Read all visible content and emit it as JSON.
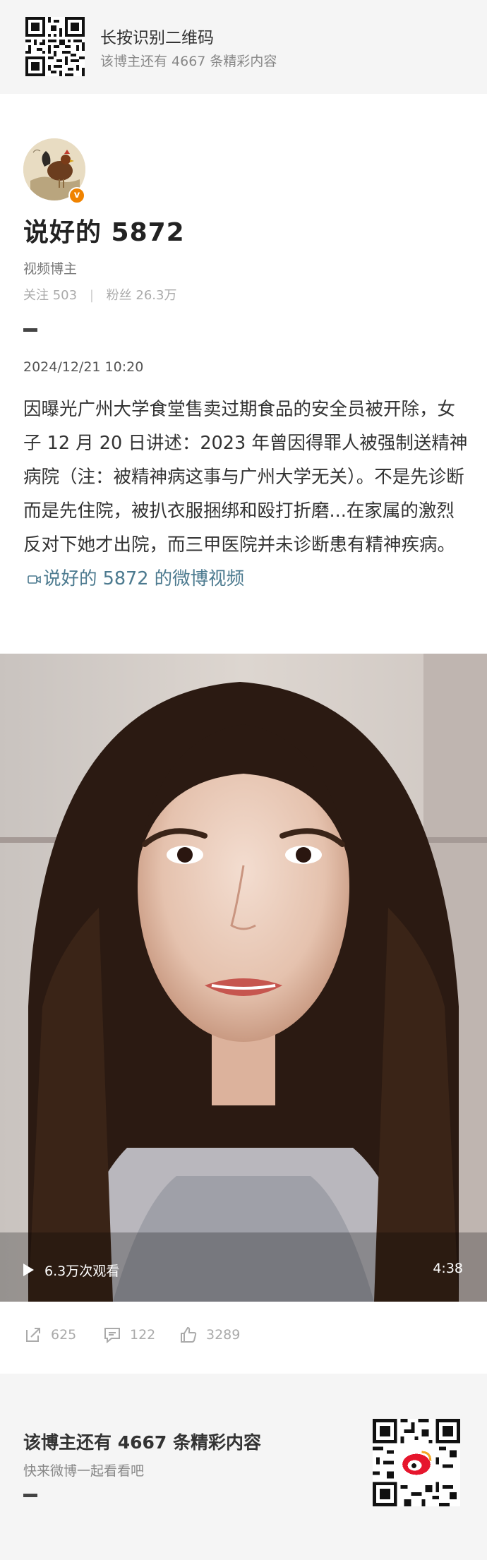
{
  "top_banner": {
    "title": "长按识别二维码",
    "subtitle": "该博主还有 4667 条精彩内容"
  },
  "profile": {
    "username": "说好的 5872",
    "role": "视频博主",
    "stats": {
      "following_label": "关注",
      "following_value": "503",
      "followers_label": "粉丝",
      "followers_value": "26.3万"
    },
    "verified_color": "#f08300"
  },
  "post": {
    "timestamp": "2024/12/21 10:20",
    "text": "因曝光广州大学食堂售卖过期食品的安全员被开除，女子 12 月 20 日讲述：2023 年曾因得罪人被强制送精神病院（注：被精神病这事与广州大学无关）。不是先诊断而是先住院，被扒衣服捆绑和殴打折磨...在家属的激烈反对下她才出院，而三甲医院并未诊断患有精神疾病。",
    "video_link": "说好的 5872 的微博视频",
    "link_color": "#4c7a8f"
  },
  "video": {
    "views": "6.3万次观看",
    "duration": "4:38"
  },
  "actions": {
    "reposts": "625",
    "comments": "122",
    "likes": "3289"
  },
  "bottom_card": {
    "title": "该博主还有 4667 条精彩内容",
    "subtitle": "快来微博一起看看吧"
  }
}
